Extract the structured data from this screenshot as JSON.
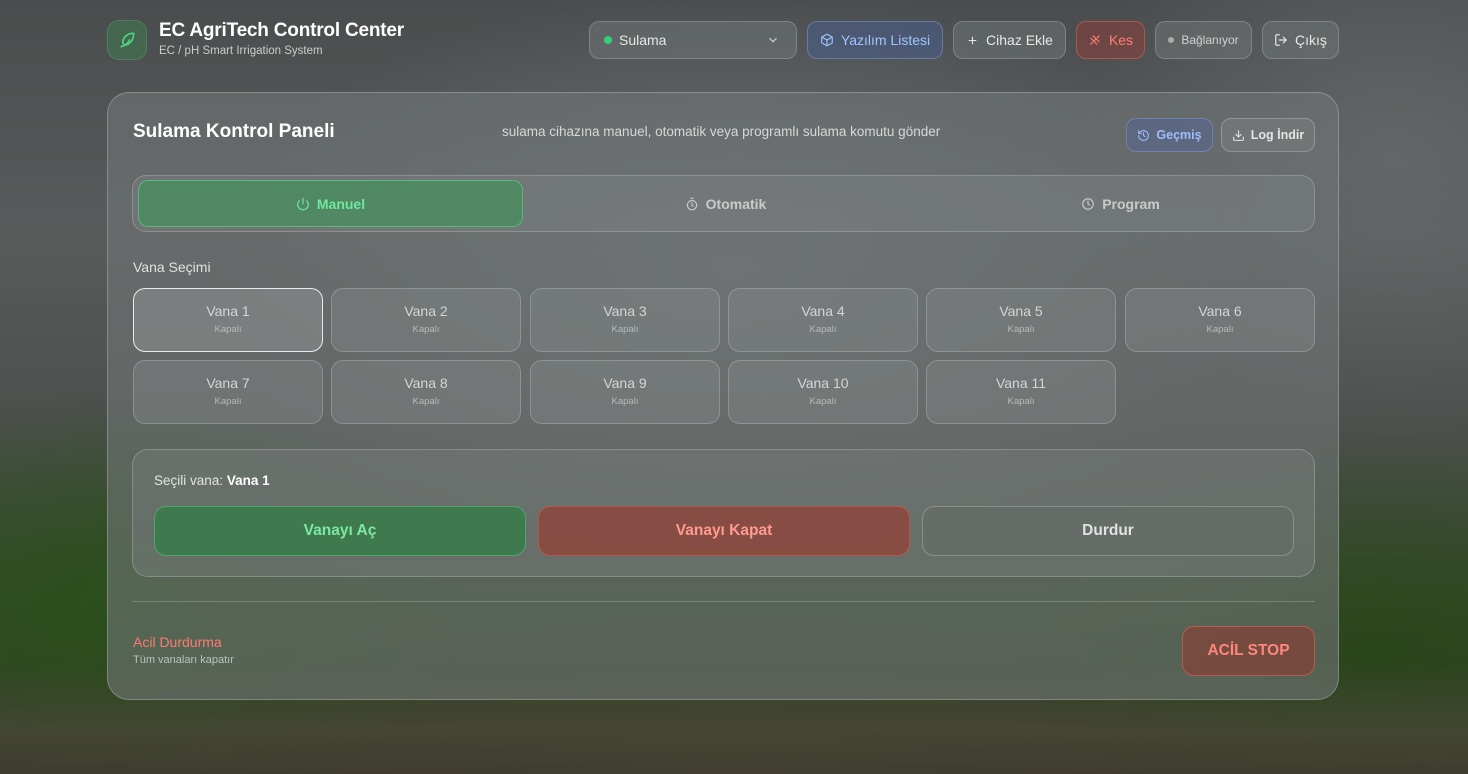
{
  "header": {
    "title": "EC AgriTech Control Center",
    "subtitle": "EC / pH Smart Irrigation System",
    "logo_icon": "leaf-icon",
    "device_select": {
      "value": "Sulama",
      "status_color": "#35d07a"
    },
    "buttons": {
      "software_list": "Yazılım Listesi",
      "add_device": "Cihaz Ekle",
      "disconnect": "Kes",
      "connection_status": "Bağlanıyor",
      "logout": "Çıkış"
    }
  },
  "panel": {
    "title": "Sulama Kontrol Paneli",
    "description": "sulama cihazına manuel, otomatik veya programlı sulama komutu gönder",
    "history_button": "Geçmiş",
    "log_button": "Log İndir",
    "tabs": [
      {
        "label": "Manuel",
        "icon": "power-icon",
        "active": true
      },
      {
        "label": "Otomatik",
        "icon": "timer-icon",
        "active": false
      },
      {
        "label": "Program",
        "icon": "clock-icon",
        "active": false
      }
    ],
    "valve_section_label": "Vana Seçimi",
    "valves": [
      {
        "name": "Vana 1",
        "state": "Kapalı"
      },
      {
        "name": "Vana 2",
        "state": "Kapalı"
      },
      {
        "name": "Vana 3",
        "state": "Kapalı"
      },
      {
        "name": "Vana 4",
        "state": "Kapalı"
      },
      {
        "name": "Vana 5",
        "state": "Kapalı"
      },
      {
        "name": "Vana 6",
        "state": "Kapalı"
      },
      {
        "name": "Vana 7",
        "state": "Kapalı"
      },
      {
        "name": "Vana 8",
        "state": "Kapalı"
      },
      {
        "name": "Vana 9",
        "state": "Kapalı"
      },
      {
        "name": "Vana 10",
        "state": "Kapalı"
      },
      {
        "name": "Vana 11",
        "state": "Kapalı"
      }
    ],
    "selected_valve_index": 0,
    "selection": {
      "label": "Seçili vana:",
      "value": "Vana 1",
      "open_button": "Vanayı Aç",
      "close_button": "Vanayı Kapat",
      "stop_button": "Durdur"
    },
    "emergency": {
      "title": "Acil Durdurma",
      "subtitle": "Tüm vanaları kapatır",
      "button": "ACİL STOP"
    }
  },
  "colors": {
    "accent_green": "#6ee89a",
    "danger_red": "#ff7a70",
    "info_blue": "#9ec4ff"
  }
}
